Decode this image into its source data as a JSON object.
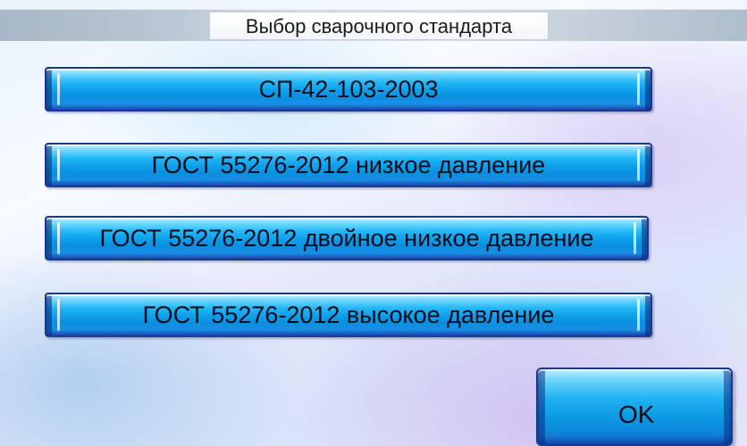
{
  "title": "Выбор сварочного стандарта",
  "standards": [
    {
      "label": "СП-42-103-2003"
    },
    {
      "label": "ГОСТ 55276-2012 низкое давление"
    },
    {
      "label": "ГОСТ 55276-2012 двойное низкое давление"
    },
    {
      "label": "ГОСТ 55276-2012 высокое давление"
    }
  ],
  "ok_button": {
    "label": "OK"
  },
  "colors": {
    "button_blue": "#0ea0ea",
    "button_border": "#1a3a8a",
    "title_bar": "#b9c6d3"
  }
}
